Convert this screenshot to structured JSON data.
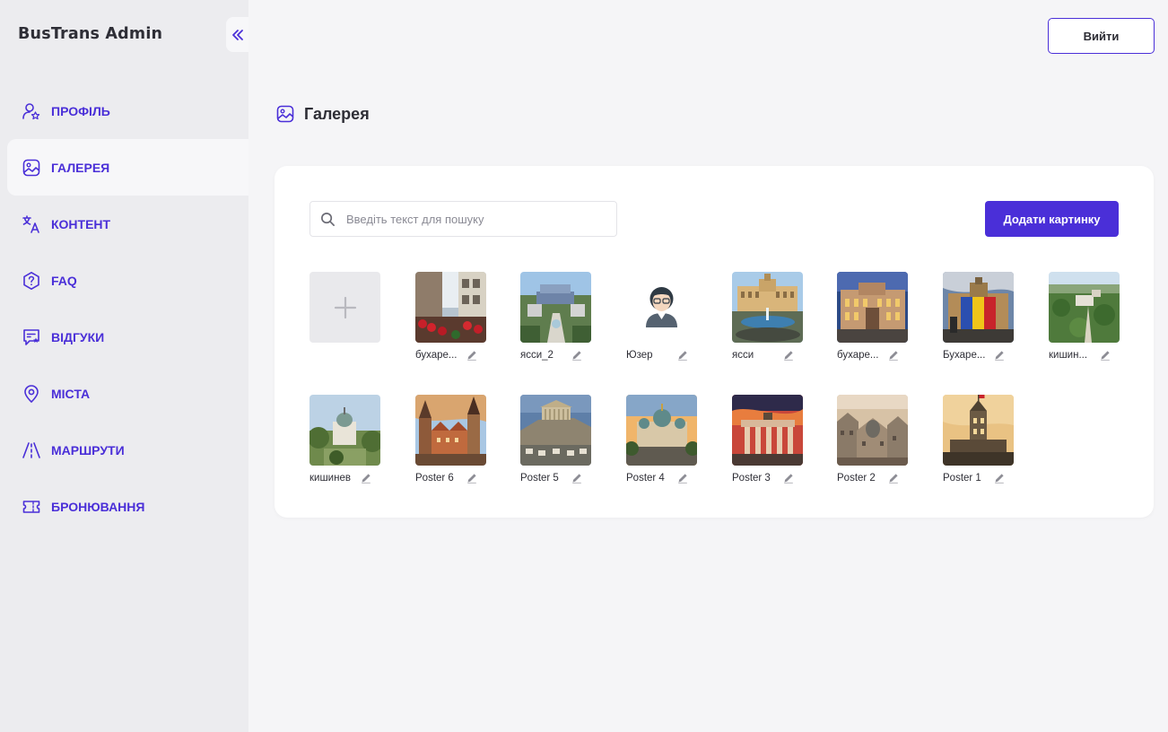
{
  "app": {
    "title": "BusTrans Admin"
  },
  "sidebar": {
    "items": [
      {
        "label": "ПРОФІЛЬ",
        "icon": "user-star-icon",
        "active": false
      },
      {
        "label": "ГАЛЕРЕЯ",
        "icon": "gallery-icon",
        "active": true
      },
      {
        "label": "КОНТЕНТ",
        "icon": "translate-icon",
        "active": false
      },
      {
        "label": "FAQ",
        "icon": "question-hexagon-icon",
        "active": false
      },
      {
        "label": "ВІДГУКИ",
        "icon": "review-icon",
        "active": false
      },
      {
        "label": "МІСТА",
        "icon": "map-pin-icon",
        "active": false
      },
      {
        "label": "МАРШРУТИ",
        "icon": "route-icon",
        "active": false
      },
      {
        "label": "БРОНЮВАННЯ",
        "icon": "ticket-icon",
        "active": false
      }
    ]
  },
  "header": {
    "logout_label": "Вийти"
  },
  "page": {
    "title": "Галерея"
  },
  "toolbar": {
    "search_placeholder": "Введіть текст для пошуку",
    "add_label": "Додати картинку"
  },
  "colors": {
    "accent": "#4a2fd8",
    "sidebar_bg": "#ececef",
    "page_bg": "#f5f5f7"
  },
  "gallery": [
    {
      "name": "бухаре...",
      "scene": "street"
    },
    {
      "name": "ясси_2",
      "scene": "aerial"
    },
    {
      "name": "Юзер",
      "scene": "avatar"
    },
    {
      "name": "ясси",
      "scene": "palace"
    },
    {
      "name": "бухаре...",
      "scene": "dusk"
    },
    {
      "name": "Бухаре...",
      "scene": "flagpalace"
    },
    {
      "name": "кишин...",
      "scene": "greencity"
    },
    {
      "name": "кишинев",
      "scene": "church"
    },
    {
      "name": "Poster 6",
      "scene": "oldtown"
    },
    {
      "name": "Poster 5",
      "scene": "acropolis"
    },
    {
      "name": "Poster 4",
      "scene": "cathedral"
    },
    {
      "name": "Poster 3",
      "scene": "gate"
    },
    {
      "name": "Poster 2",
      "scene": "rooftops"
    },
    {
      "name": "Poster 1",
      "scene": "tower"
    }
  ]
}
